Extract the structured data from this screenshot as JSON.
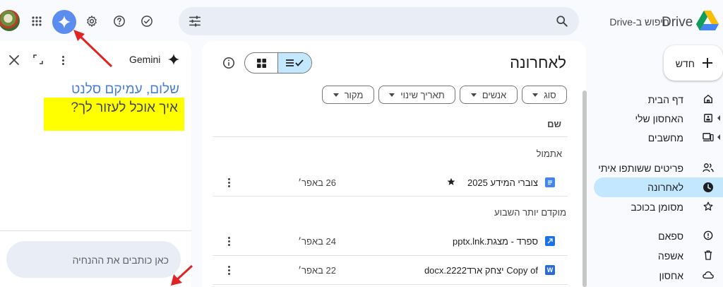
{
  "header": {
    "drive_title": "Drive",
    "search_placeholder": "חיפוש ב-Drive"
  },
  "gemini": {
    "title": "Gemini",
    "greeting_line1": "שלום, עמיקם סלנט",
    "greeting_line2": "איך אוכל לעזור לך?",
    "prompt_placeholder": "כאן כותבים את ההנחיה"
  },
  "main": {
    "title": "לאחרונה",
    "filters": [
      "סוג",
      "אנשים",
      "תאריך שינוי",
      "מקור"
    ],
    "column_name": "שם",
    "groups": [
      {
        "label": "אתמול",
        "rows": [
          {
            "name": "צוברי המידע 2025",
            "starred": true,
            "date": "26 באפר׳",
            "icon": "docs-icon"
          }
        ]
      },
      {
        "label": "מוקדם יותר השבוע",
        "rows": [
          {
            "name": "ספרד - מצגת.pptx.lnk",
            "starred": false,
            "date": "24 באפר׳",
            "icon": "link-file-icon"
          },
          {
            "name": "Copy of יצחק ארד2222.docx",
            "starred": false,
            "date": "22 באפר׳",
            "icon": "word-icon"
          }
        ]
      }
    ]
  },
  "sidebar": {
    "new_label": "חדש",
    "items": [
      {
        "label": "דף הבית",
        "icon": "home-icon"
      },
      {
        "label": "האחסון שלי",
        "icon": "my-drive-icon"
      },
      {
        "label": "מחשבים",
        "icon": "computers-icon"
      },
      {
        "label": "פריטים ששותפו איתי",
        "icon": "shared-icon"
      },
      {
        "label": "לאחרונה",
        "icon": "clock-icon",
        "active": true
      },
      {
        "label": "מסומן בכוכב",
        "icon": "star-icon"
      },
      {
        "label": "ספאם",
        "icon": "spam-icon"
      },
      {
        "label": "אשפה",
        "icon": "trash-icon"
      },
      {
        "label": "אחסון",
        "icon": "cloud-icon"
      }
    ]
  },
  "colors": {
    "accent_active": "#c2e7ff",
    "highlight": "#ffff00",
    "annotation_arrow": "#e02424"
  }
}
